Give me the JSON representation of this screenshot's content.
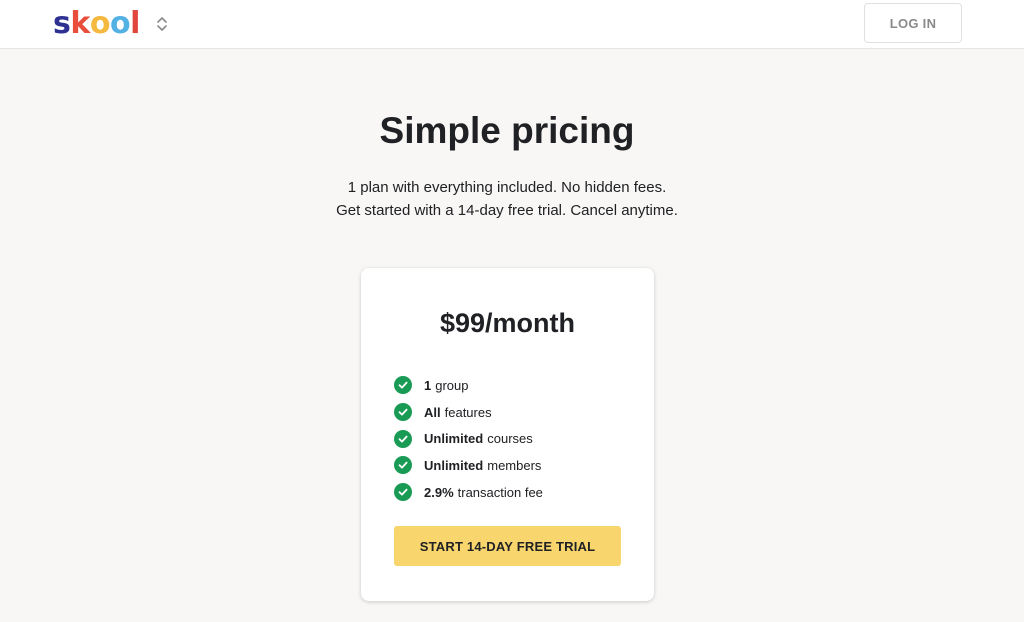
{
  "header": {
    "logo": {
      "letters": [
        {
          "char": "s",
          "color": "#2e3192"
        },
        {
          "char": "k",
          "color": "#e94e3c"
        },
        {
          "char": "o",
          "color": "#f4b93e"
        },
        {
          "char": "o",
          "color": "#54b1e4"
        },
        {
          "char": "l",
          "color": "#e1463d"
        }
      ]
    },
    "switcher_icon": "chevron-up-down-icon",
    "login_label": "LOG IN"
  },
  "hero": {
    "title": "Simple pricing",
    "subtitle_line1": "1 plan with everything included. No hidden fees.",
    "subtitle_line2": "Get started with a 14-day free trial. Cancel anytime."
  },
  "plan": {
    "price": "$99/month",
    "features": [
      {
        "bold": "1",
        "text": "group"
      },
      {
        "bold": "All",
        "text": "features"
      },
      {
        "bold": "Unlimited",
        "text": "courses"
      },
      {
        "bold": "Unlimited",
        "text": "members"
      },
      {
        "bold": "2.9%",
        "text": "transaction fee"
      }
    ],
    "check_icon": "check-circle-icon",
    "check_color": "#1a9b55",
    "cta_label": "START 14-DAY FREE TRIAL",
    "cta_color": "#f8d66d"
  }
}
